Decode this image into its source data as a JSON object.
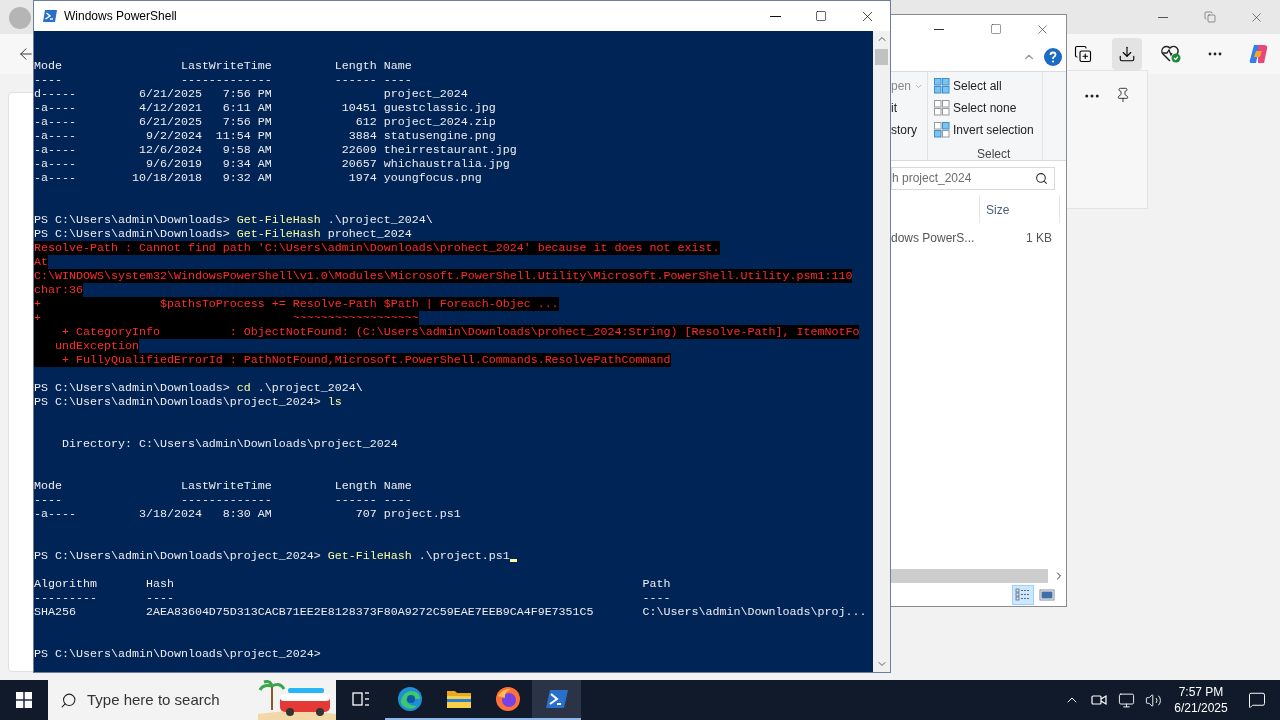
{
  "browser": {
    "toolbar_buttons": [
      {
        "kind": "collections",
        "selected": false
      },
      {
        "kind": "downloads",
        "selected": true
      },
      {
        "kind": "health",
        "selected": false
      },
      {
        "kind": "more",
        "selected": false
      },
      {
        "kind": "copilot",
        "selected": false
      }
    ]
  },
  "explorer": {
    "ribbon_items": [
      {
        "label": "pen",
        "dropdown": true,
        "disabled": true
      },
      {
        "label": "it",
        "dropdown": false,
        "disabled": false
      },
      {
        "label": "story",
        "dropdown": false,
        "disabled": false
      }
    ],
    "select_group": {
      "label": "Select",
      "items": [
        {
          "kind": "all",
          "label": "Select all"
        },
        {
          "kind": "none",
          "label": "Select none"
        },
        {
          "kind": "invert",
          "label": "Invert selection"
        }
      ]
    },
    "search": {
      "placeholder": "h project_2024"
    },
    "columns": [
      "Size"
    ],
    "rows": [
      {
        "name": "dows PowerS...",
        "size": "1 KB"
      }
    ],
    "view_buttons": [
      {
        "kind": "details",
        "selected": true
      },
      {
        "kind": "preview",
        "selected": false
      }
    ]
  },
  "powershell": {
    "title": "Windows PowerShell",
    "lines": [
      {
        "kind": "output",
        "text": "Mode                 LastWriteTime         Length Name"
      },
      {
        "kind": "output",
        "text": "----                 -------------         ------ ----"
      },
      {
        "kind": "output",
        "text": "d-----         6/21/2025   7:56 PM                project_2024"
      },
      {
        "kind": "output",
        "text": "-a----         4/12/2021   6:11 AM          10451 guestclassic.jpg"
      },
      {
        "kind": "output",
        "text": "-a----         6/21/2025   7:56 PM            612 project_2024.zip"
      },
      {
        "kind": "output",
        "text": "-a----          9/2/2024  11:54 PM           3884 statusengine.png"
      },
      {
        "kind": "output",
        "text": "-a----         12/6/2024   9:58 AM          22609 theirrestaurant.jpg"
      },
      {
        "kind": "output",
        "text": "-a----          9/6/2019   9:34 AM          20657 whichaustralia.jpg"
      },
      {
        "kind": "output",
        "text": "-a----        10/18/2018   9:32 AM           1974 youngfocus.png"
      },
      {
        "kind": "blank"
      },
      {
        "kind": "blank"
      },
      {
        "kind": "command",
        "prompt": "PS C:\\Users\\admin\\Downloads>",
        "command": "Get-FileHash",
        "args": ".\\project_2024\\",
        "cursor": false
      },
      {
        "kind": "command",
        "prompt": "PS C:\\Users\\admin\\Downloads>",
        "command": "Get-FileHash",
        "args": "prohect_2024",
        "cursor": false
      },
      {
        "kind": "error",
        "text": "Resolve-Path : Cannot find path 'C:\\Users\\admin\\Downloads\\prohect_2024' because it does not exist."
      },
      {
        "kind": "error",
        "text": "At"
      },
      {
        "kind": "error",
        "text": "C:\\WINDOWS\\system32\\WindowsPowerShell\\v1.0\\Modules\\Microsoft.PowerShell.Utility\\Microsoft.PowerShell.Utility.psm1:110"
      },
      {
        "kind": "error",
        "text": "char:36"
      },
      {
        "kind": "error",
        "text": "+                 $pathsToProcess += Resolve-Path $Path | Foreach-Objec ..."
      },
      {
        "kind": "error",
        "text": "+                                    ~~~~~~~~~~~~~~~~~~"
      },
      {
        "kind": "error",
        "text": "    + CategoryInfo          : ObjectNotFound: (C:\\Users\\admin\\Downloads\\prohect_2024:String) [Resolve-Path], ItemNotFo"
      },
      {
        "kind": "error",
        "text": "   undException"
      },
      {
        "kind": "error",
        "text": "    + FullyQualifiedErrorId : PathNotFound,Microsoft.PowerShell.Commands.ResolvePathCommand"
      },
      {
        "kind": "blank"
      },
      {
        "kind": "command",
        "prompt": "PS C:\\Users\\admin\\Downloads>",
        "command": "cd",
        "args": ".\\project_2024\\",
        "cursor": false
      },
      {
        "kind": "command",
        "prompt": "PS C:\\Users\\admin\\Downloads\\project_2024>",
        "command": "ls",
        "cursor": false
      },
      {
        "kind": "blank"
      },
      {
        "kind": "blank"
      },
      {
        "kind": "output",
        "text": "    Directory: C:\\Users\\admin\\Downloads\\project_2024"
      },
      {
        "kind": "blank"
      },
      {
        "kind": "blank"
      },
      {
        "kind": "output",
        "text": "Mode                 LastWriteTime         Length Name"
      },
      {
        "kind": "output",
        "text": "----                 -------------         ------ ----"
      },
      {
        "kind": "output",
        "text": "-a----         3/18/2024   8:30 AM            707 project.ps1"
      },
      {
        "kind": "blank"
      },
      {
        "kind": "blank"
      },
      {
        "kind": "command",
        "prompt": "PS C:\\Users\\admin\\Downloads\\project_2024>",
        "command": "Get-FileHash",
        "args": ".\\project.ps1",
        "cursor": true
      },
      {
        "kind": "blank"
      },
      {
        "kind": "output",
        "text": "Algorithm       Hash                                                                   Path"
      },
      {
        "kind": "output",
        "text": "---------       ----                                                                   ----"
      },
      {
        "kind": "output",
        "text": "SHA256          2AEA83604D75D313CACB71EE2E8128373F80A9272C59EAE7EEB9CA4F9E7351C5       C:\\Users\\admin\\Downloads\\proj..."
      },
      {
        "kind": "blank"
      },
      {
        "kind": "blank"
      },
      {
        "kind": "command",
        "prompt": "PS C:\\Users\\admin\\Downloads\\project_2024>",
        "cursor": false
      }
    ]
  },
  "taskbar": {
    "search": {
      "placeholder": "Type here to search"
    },
    "apps": [
      {
        "kind": "task-view",
        "running": false,
        "active": false
      },
      {
        "kind": "edge",
        "running": true,
        "active": false
      },
      {
        "kind": "explorer",
        "running": true,
        "active": false
      },
      {
        "kind": "firefox",
        "running": true,
        "active": false
      },
      {
        "kind": "powershell",
        "running": true,
        "active": true
      }
    ],
    "clock": {
      "time": "7:57 PM",
      "date": "6/21/2025"
    }
  }
}
